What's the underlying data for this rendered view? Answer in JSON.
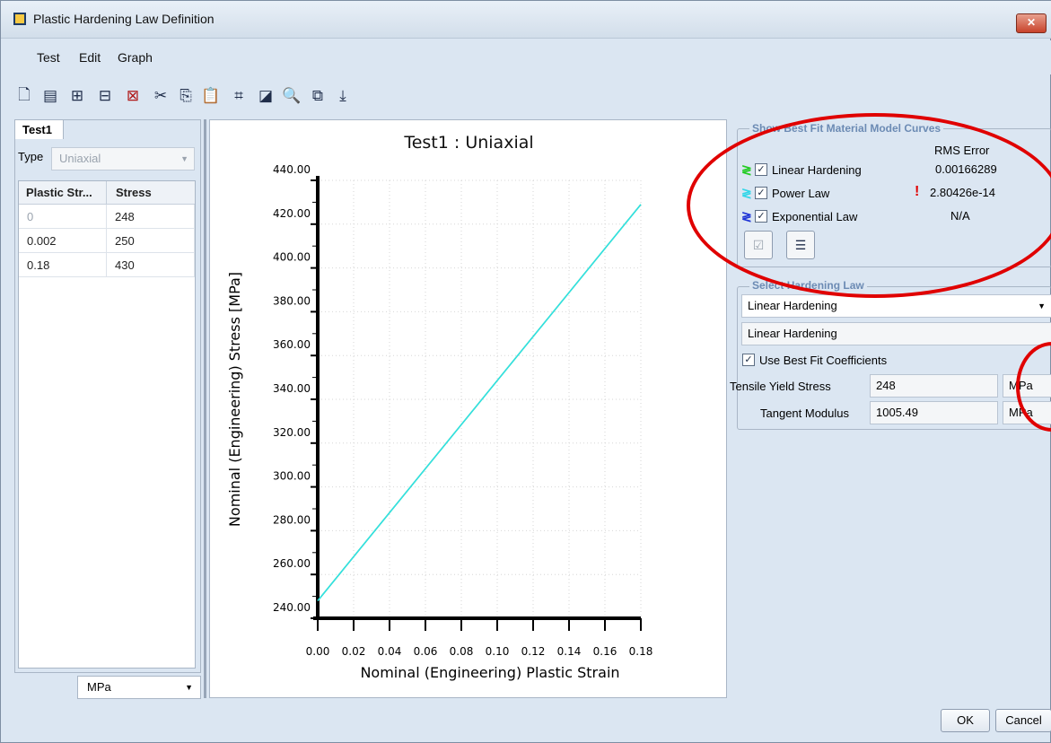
{
  "window": {
    "title": "Plastic Hardening Law Definition",
    "close_symbol": "✕"
  },
  "menu": {
    "items": [
      "Test",
      "Edit",
      "Graph"
    ]
  },
  "toolbar": {
    "icons": [
      "new-icon",
      "properties-icon",
      "insert-row-icon",
      "append-row-icon",
      "delete-icon",
      "cut-icon",
      "copy-icon",
      "paste-icon",
      "select-all-icon",
      "fit-icon",
      "zoom-icon",
      "zoom-window-icon",
      "export-icon"
    ]
  },
  "left": {
    "tab_label": "Test1",
    "type_label": "Type",
    "type_value": "Uniaxial",
    "columns": [
      "Plastic Str...",
      "Stress"
    ],
    "rows": [
      [
        "0",
        "248"
      ],
      [
        "0.002",
        "250"
      ],
      [
        "0.18",
        "430"
      ]
    ],
    "unit": "MPa"
  },
  "chart_data": {
    "type": "line",
    "title": "Test1 : Uniaxial",
    "xlabel": "Nominal (Engineering) Plastic Strain",
    "ylabel": "Nominal (Engineering) Stress [MPa]",
    "xlim": [
      0,
      0.18
    ],
    "ylim": [
      240,
      440
    ],
    "x_ticks": [
      "0.00",
      "0.02",
      "0.04",
      "0.06",
      "0.08",
      "0.10",
      "0.12",
      "0.14",
      "0.16",
      "0.18"
    ],
    "y_ticks": [
      "240.00",
      "260.00",
      "280.00",
      "300.00",
      "320.00",
      "340.00",
      "360.00",
      "380.00",
      "400.00",
      "420.00",
      "440.00"
    ],
    "grid": true,
    "series": [
      {
        "name": "Linear Hardening",
        "color": "#2ecc40",
        "x": [
          0,
          0.18
        ],
        "y": [
          248,
          429
        ]
      },
      {
        "name": "Power Law",
        "color": "#30e0e8",
        "x": [
          0,
          0.18
        ],
        "y": [
          248,
          429
        ]
      }
    ]
  },
  "best_fit": {
    "legend": "Show Best Fit Material Model Curves",
    "rms_header": "RMS Error",
    "curves": [
      {
        "name": "Linear Hardening",
        "rms": "0.00166289",
        "color": "#22cc22",
        "checked": true
      },
      {
        "name": "Power Law",
        "rms": "2.80426e-14",
        "color": "#33d6e8",
        "checked": true,
        "warning": true
      },
      {
        "name": "Exponential Law",
        "rms": "N/A",
        "color": "#1f35d6",
        "checked": true
      }
    ]
  },
  "hardening": {
    "legend": "Select Hardening Law",
    "selected": "Linear Hardening",
    "name_field": "Linear Hardening",
    "use_best_fit_label": "Use Best Fit Coefficients",
    "params": [
      {
        "label": "Tensile Yield Stress",
        "value": "248",
        "unit": "MPa"
      },
      {
        "label": "Tangent Modulus",
        "value": "1005.49",
        "unit": "MPa"
      }
    ]
  },
  "buttons": {
    "ok": "OK",
    "cancel": "Cancel"
  },
  "colors": {
    "annotation": "#e00000",
    "window_bg": "#dbe6f2",
    "legend_text": "#6c8bb4"
  }
}
